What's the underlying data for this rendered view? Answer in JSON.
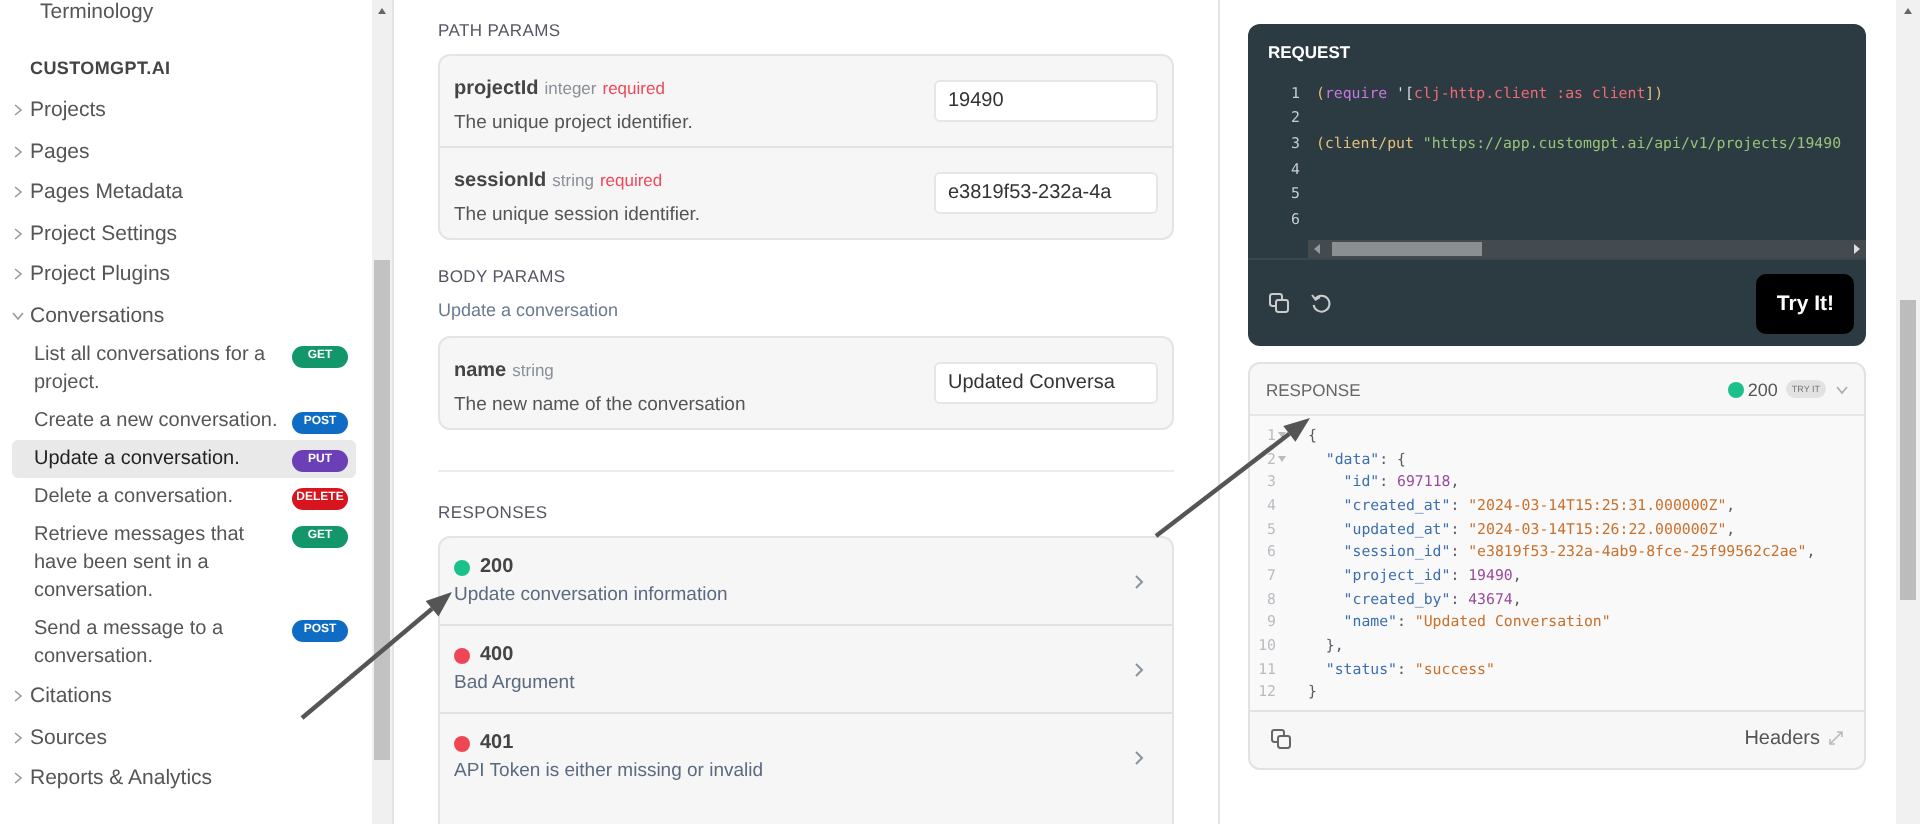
{
  "sidebar": {
    "top_item": "Terminology",
    "section": "CUSTOMGPT.AI",
    "items": [
      {
        "label": "Projects",
        "expanded": false
      },
      {
        "label": "Pages",
        "expanded": false
      },
      {
        "label": "Pages Metadata",
        "expanded": false
      },
      {
        "label": "Project Settings",
        "expanded": false
      },
      {
        "label": "Project Plugins",
        "expanded": false
      },
      {
        "label": "Conversations",
        "expanded": true,
        "children": [
          {
            "label": "List all conversations for a project.",
            "method": "GET",
            "color": "#12966a",
            "selected": false
          },
          {
            "label": "Create a new conversation.",
            "method": "POST",
            "color": "#0f6cc4",
            "selected": false
          },
          {
            "label": "Update a conversation.",
            "method": "PUT",
            "color": "#6b3fb5",
            "selected": true
          },
          {
            "label": "Delete a conversation.",
            "method": "DELETE",
            "color": "#d8151f",
            "selected": false
          },
          {
            "label": "Retrieve messages that have been sent in a conversation.",
            "method": "GET",
            "color": "#12966a",
            "selected": false
          },
          {
            "label": "Send a message to a conversation.",
            "method": "POST",
            "color": "#0f6cc4",
            "selected": false
          }
        ]
      },
      {
        "label": "Citations",
        "expanded": false
      },
      {
        "label": "Sources",
        "expanded": false
      },
      {
        "label": "Reports & Analytics",
        "expanded": false
      }
    ]
  },
  "path_params": {
    "heading": "PATH PARAMS",
    "params": [
      {
        "name": "projectId",
        "type": "integer",
        "required_label": "required",
        "description": "The unique project identifier.",
        "value": "19490"
      },
      {
        "name": "sessionId",
        "type": "string",
        "required_label": "required",
        "description": "The unique session identifier.",
        "value": "e3819f53-232a-4a"
      }
    ]
  },
  "body_params": {
    "heading": "BODY PARAMS",
    "description": "Update a conversation",
    "params": [
      {
        "name": "name",
        "type": "string",
        "description": "The new name of the conversation",
        "value": "Updated Conversa"
      }
    ]
  },
  "responses": {
    "heading": "RESPONSES",
    "items": [
      {
        "code": "200",
        "description": "Update conversation information",
        "color": "#1cc08a"
      },
      {
        "code": "400",
        "description": "Bad Argument",
        "color": "#ef4656"
      },
      {
        "code": "401",
        "description": "API Token is either missing or invalid",
        "color": "#ef4656"
      }
    ]
  },
  "request": {
    "title": "REQUEST",
    "button": "Try It!",
    "lines": [
      {
        "number": "1",
        "tokens": [
          {
            "text": "(",
            "kind": "paren"
          },
          {
            "text": "require",
            "kind": "keyword"
          },
          {
            "text": " '[",
            "kind": "punct"
          },
          {
            "text": "clj-http.client :as client",
            "kind": "symbol"
          },
          {
            "text": "])",
            "kind": "paren"
          }
        ]
      },
      {
        "number": "2"
      },
      {
        "number": "3",
        "tokens": [
          {
            "text": "(client/put ",
            "kind": "fn"
          },
          {
            "text": "\"https://app.customgpt.ai/api/v1/projects/19490",
            "kind": "string"
          }
        ]
      },
      {
        "number": "4"
      },
      {
        "number": "5"
      },
      {
        "number": "6"
      }
    ]
  },
  "response": {
    "title": "RESPONSE",
    "status": {
      "code": "200",
      "color": "#1cc08a"
    },
    "badge": "TRY IT",
    "headers_label": "Headers",
    "lines": [
      {
        "number": "1",
        "foldable": true,
        "tokens": [
          {
            "text": "{",
            "kind": "punct"
          }
        ]
      },
      {
        "number": "2",
        "foldable": true,
        "tokens": [
          {
            "text": "  \"data\"",
            "kind": "key"
          },
          {
            "text": ": {",
            "kind": "punct"
          }
        ]
      },
      {
        "number": "3",
        "foldable": false,
        "tokens": [
          {
            "text": "    \"id\"",
            "kind": "key"
          },
          {
            "text": ": ",
            "kind": "punct"
          },
          {
            "text": "697118",
            "kind": "number"
          },
          {
            "text": ",",
            "kind": "punct"
          }
        ]
      },
      {
        "number": "4",
        "foldable": false,
        "tokens": [
          {
            "text": "    \"created_at\"",
            "kind": "key"
          },
          {
            "text": ": ",
            "kind": "punct"
          },
          {
            "text": "\"2024-03-14T15:25:31.000000Z\"",
            "kind": "string"
          },
          {
            "text": ",",
            "kind": "punct"
          }
        ]
      },
      {
        "number": "5",
        "foldable": false,
        "tokens": [
          {
            "text": "    \"updated_at\"",
            "kind": "key"
          },
          {
            "text": ": ",
            "kind": "punct"
          },
          {
            "text": "\"2024-03-14T15:26:22.000000Z\"",
            "kind": "string"
          },
          {
            "text": ",",
            "kind": "punct"
          }
        ]
      },
      {
        "number": "6",
        "foldable": false,
        "tokens": [
          {
            "text": "    \"session_id\"",
            "kind": "key"
          },
          {
            "text": ": ",
            "kind": "punct"
          },
          {
            "text": "\"e3819f53-232a-4ab9-8fce-25f99562c2ae\"",
            "kind": "string"
          },
          {
            "text": ",",
            "kind": "punct"
          }
        ]
      },
      {
        "number": "7",
        "foldable": false,
        "tokens": [
          {
            "text": "    \"project_id\"",
            "kind": "key"
          },
          {
            "text": ": ",
            "kind": "punct"
          },
          {
            "text": "19490",
            "kind": "number"
          },
          {
            "text": ",",
            "kind": "punct"
          }
        ]
      },
      {
        "number": "8",
        "foldable": false,
        "tokens": [
          {
            "text": "    \"created_by\"",
            "kind": "key"
          },
          {
            "text": ": ",
            "kind": "punct"
          },
          {
            "text": "43674",
            "kind": "number"
          },
          {
            "text": ",",
            "kind": "punct"
          }
        ]
      },
      {
        "number": "9",
        "foldable": false,
        "tokens": [
          {
            "text": "    \"name\"",
            "kind": "key"
          },
          {
            "text": ": ",
            "kind": "punct"
          },
          {
            "text": "\"Updated Conversation\"",
            "kind": "string"
          }
        ]
      },
      {
        "number": "10",
        "foldable": false,
        "tokens": [
          {
            "text": "  },",
            "kind": "punct"
          }
        ]
      },
      {
        "number": "11",
        "foldable": false,
        "tokens": [
          {
            "text": "  \"status\"",
            "kind": "key"
          },
          {
            "text": ": ",
            "kind": "punct"
          },
          {
            "text": "\"success\"",
            "kind": "string"
          }
        ]
      },
      {
        "number": "12",
        "foldable": false,
        "tokens": [
          {
            "text": "}",
            "kind": "punct"
          }
        ]
      }
    ]
  }
}
